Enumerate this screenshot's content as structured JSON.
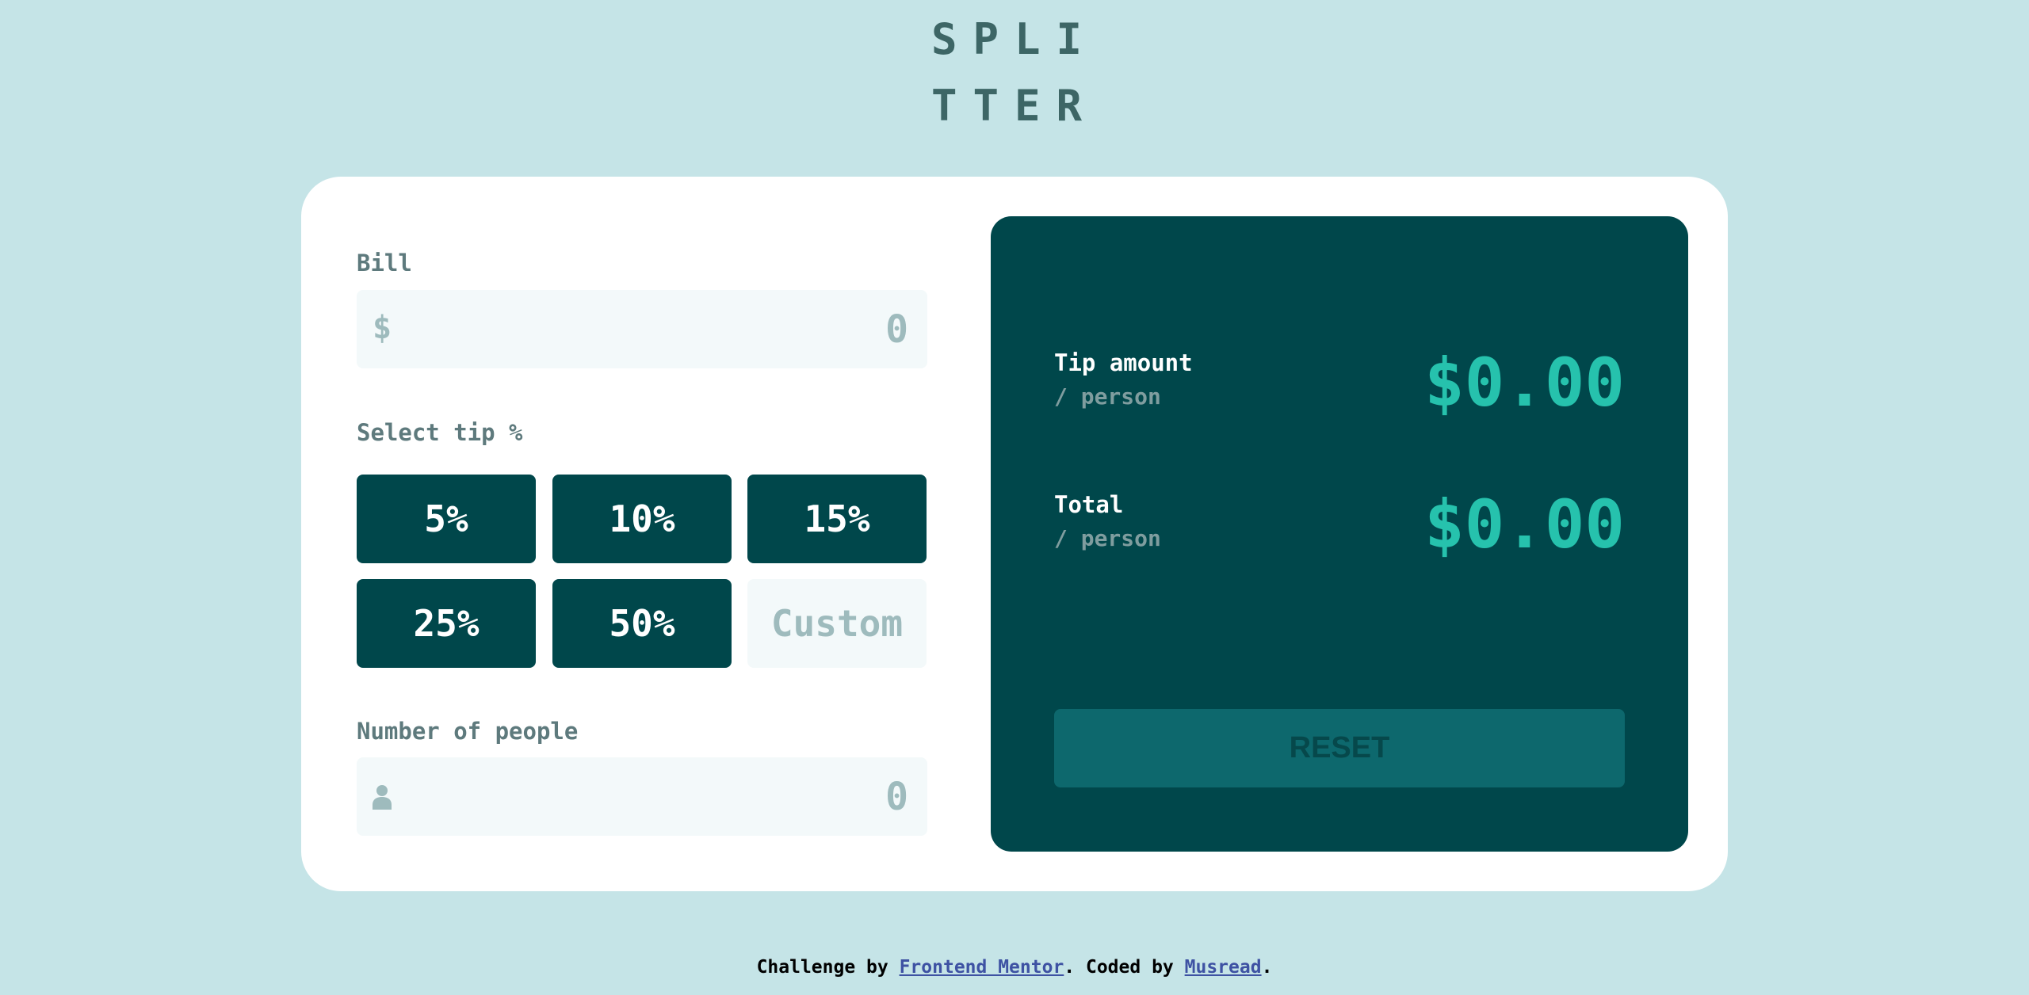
{
  "logo": {
    "line1": "SPLI",
    "line2": "TTER"
  },
  "bill": {
    "label": "Bill",
    "currency_symbol": "$",
    "value": "0"
  },
  "tip": {
    "label": "Select tip %",
    "options": [
      "5%",
      "10%",
      "15%",
      "25%",
      "50%"
    ],
    "custom_placeholder": "Custom"
  },
  "people": {
    "label": "Number of people",
    "value": "0",
    "icon": "person-icon"
  },
  "results": {
    "tip_title": "Tip amount",
    "tip_sub": "/ person",
    "tip_value": "$0.00",
    "total_title": "Total",
    "total_sub": "/ person",
    "total_value": "$0.00",
    "reset_label": "RESET"
  },
  "footer": {
    "prefix": "Challenge by ",
    "link1": "Frontend Mentor",
    "middle": ". Coded by ",
    "link2": "Musread",
    "suffix": "."
  },
  "colors": {
    "background": "#c5e4e7",
    "dark_cyan": "#00474b",
    "strong_cyan": "#26c2ad",
    "reset_bg": "#0d686d"
  }
}
